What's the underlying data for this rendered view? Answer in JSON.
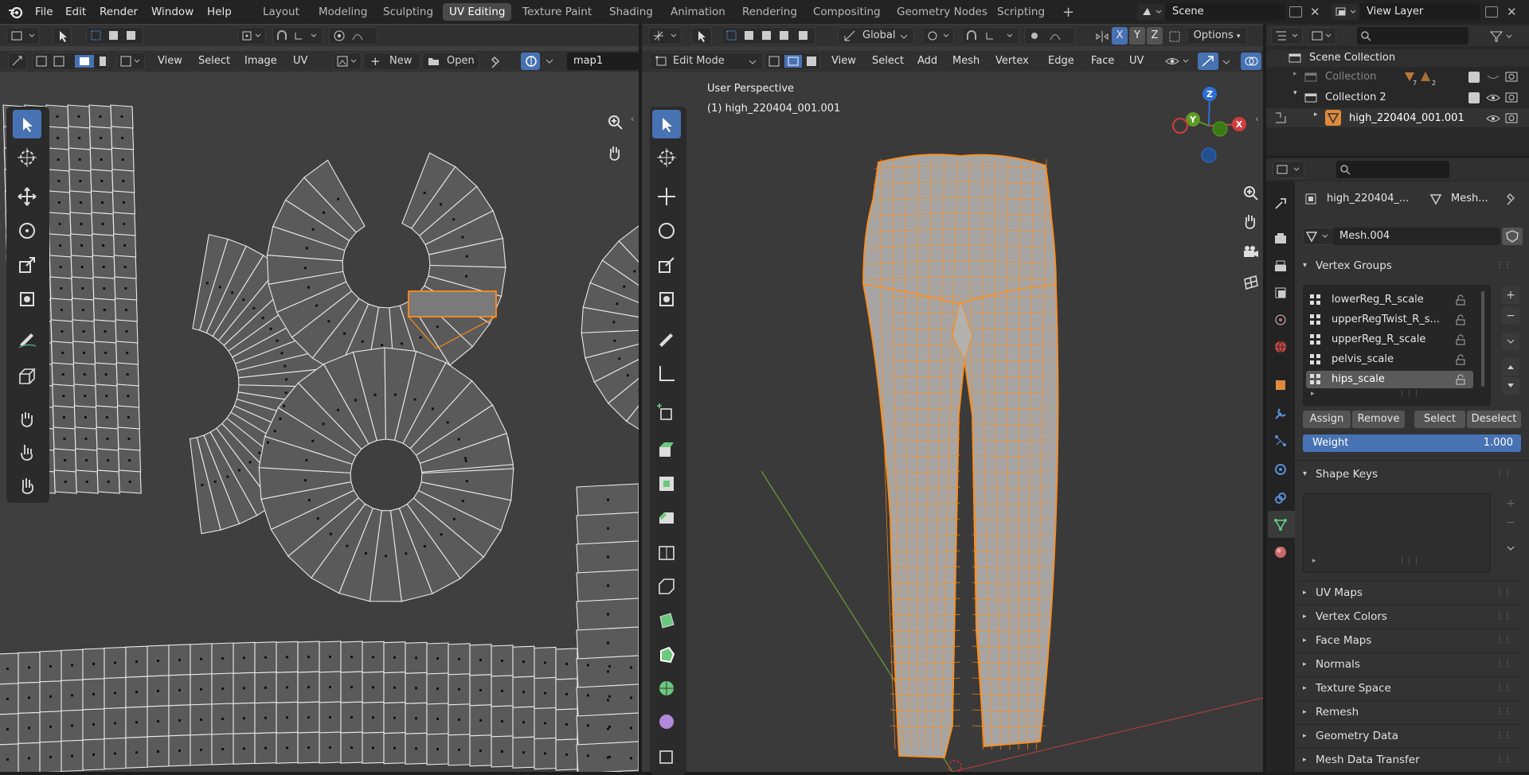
{
  "menubar": {
    "file": "File",
    "edit": "Edit",
    "render": "Render",
    "window": "Window",
    "help": "Help"
  },
  "workspaces": [
    "Layout",
    "Modeling",
    "Sculpting",
    "UV Editing",
    "Texture Paint",
    "Shading",
    "Animation",
    "Rendering",
    "Compositing",
    "Geometry Nodes",
    "Scripting"
  ],
  "active_workspace": "UV Editing",
  "scene": {
    "name": "Scene",
    "view_layer": "View Layer"
  },
  "uv_editor": {
    "menus": {
      "view": "View",
      "select": "Select",
      "image": "Image",
      "uv": "UV"
    },
    "new_label": "New",
    "open_label": "Open",
    "uv_map": "map1"
  },
  "viewport": {
    "orientation": "Global",
    "mode": "Edit Mode",
    "menus": {
      "view": "View",
      "select": "Select",
      "add": "Add",
      "mesh": "Mesh",
      "vertex": "Vertex",
      "edge": "Edge",
      "face": "Face",
      "uv": "UV"
    },
    "options_label": "Options",
    "axis_x": "X",
    "axis_y": "Y",
    "axis_z": "Z",
    "overlay_title": "User Perspective",
    "overlay_object": "(1) high_220404_001.001",
    "gizmo": {
      "x": "X",
      "y": "Y",
      "z": "Z"
    }
  },
  "outliner": {
    "root": "Scene Collection",
    "items": [
      {
        "label": "Collection",
        "badge1": "7",
        "badge2": "2"
      },
      {
        "label": "Collection 2"
      },
      {
        "label": "high_220404_001.001"
      }
    ]
  },
  "properties": {
    "object_name": "high_220404_...",
    "data_label": "Mesh...",
    "mesh_name": "Mesh.004",
    "vertex_groups_title": "Vertex Groups",
    "vertex_groups": [
      "lowerReg_R_scale",
      "upperRegTwist_R_s...",
      "upperReg_R_scale",
      "pelvis_scale",
      "hips_scale"
    ],
    "active_group_index": 4,
    "assign": "Assign",
    "remove": "Remove",
    "select": "Select",
    "deselect": "Deselect",
    "weight_label": "Weight",
    "weight_value": "1.000",
    "shape_keys_title": "Shape Keys",
    "sections": [
      "UV Maps",
      "Vertex Colors",
      "Face Maps",
      "Normals",
      "Texture Space",
      "Remesh",
      "Geometry Data",
      "Mesh Data Transfer"
    ]
  },
  "colors": {
    "accent": "#4772b3",
    "selection": "#ff8c1a",
    "header": "#303030"
  }
}
